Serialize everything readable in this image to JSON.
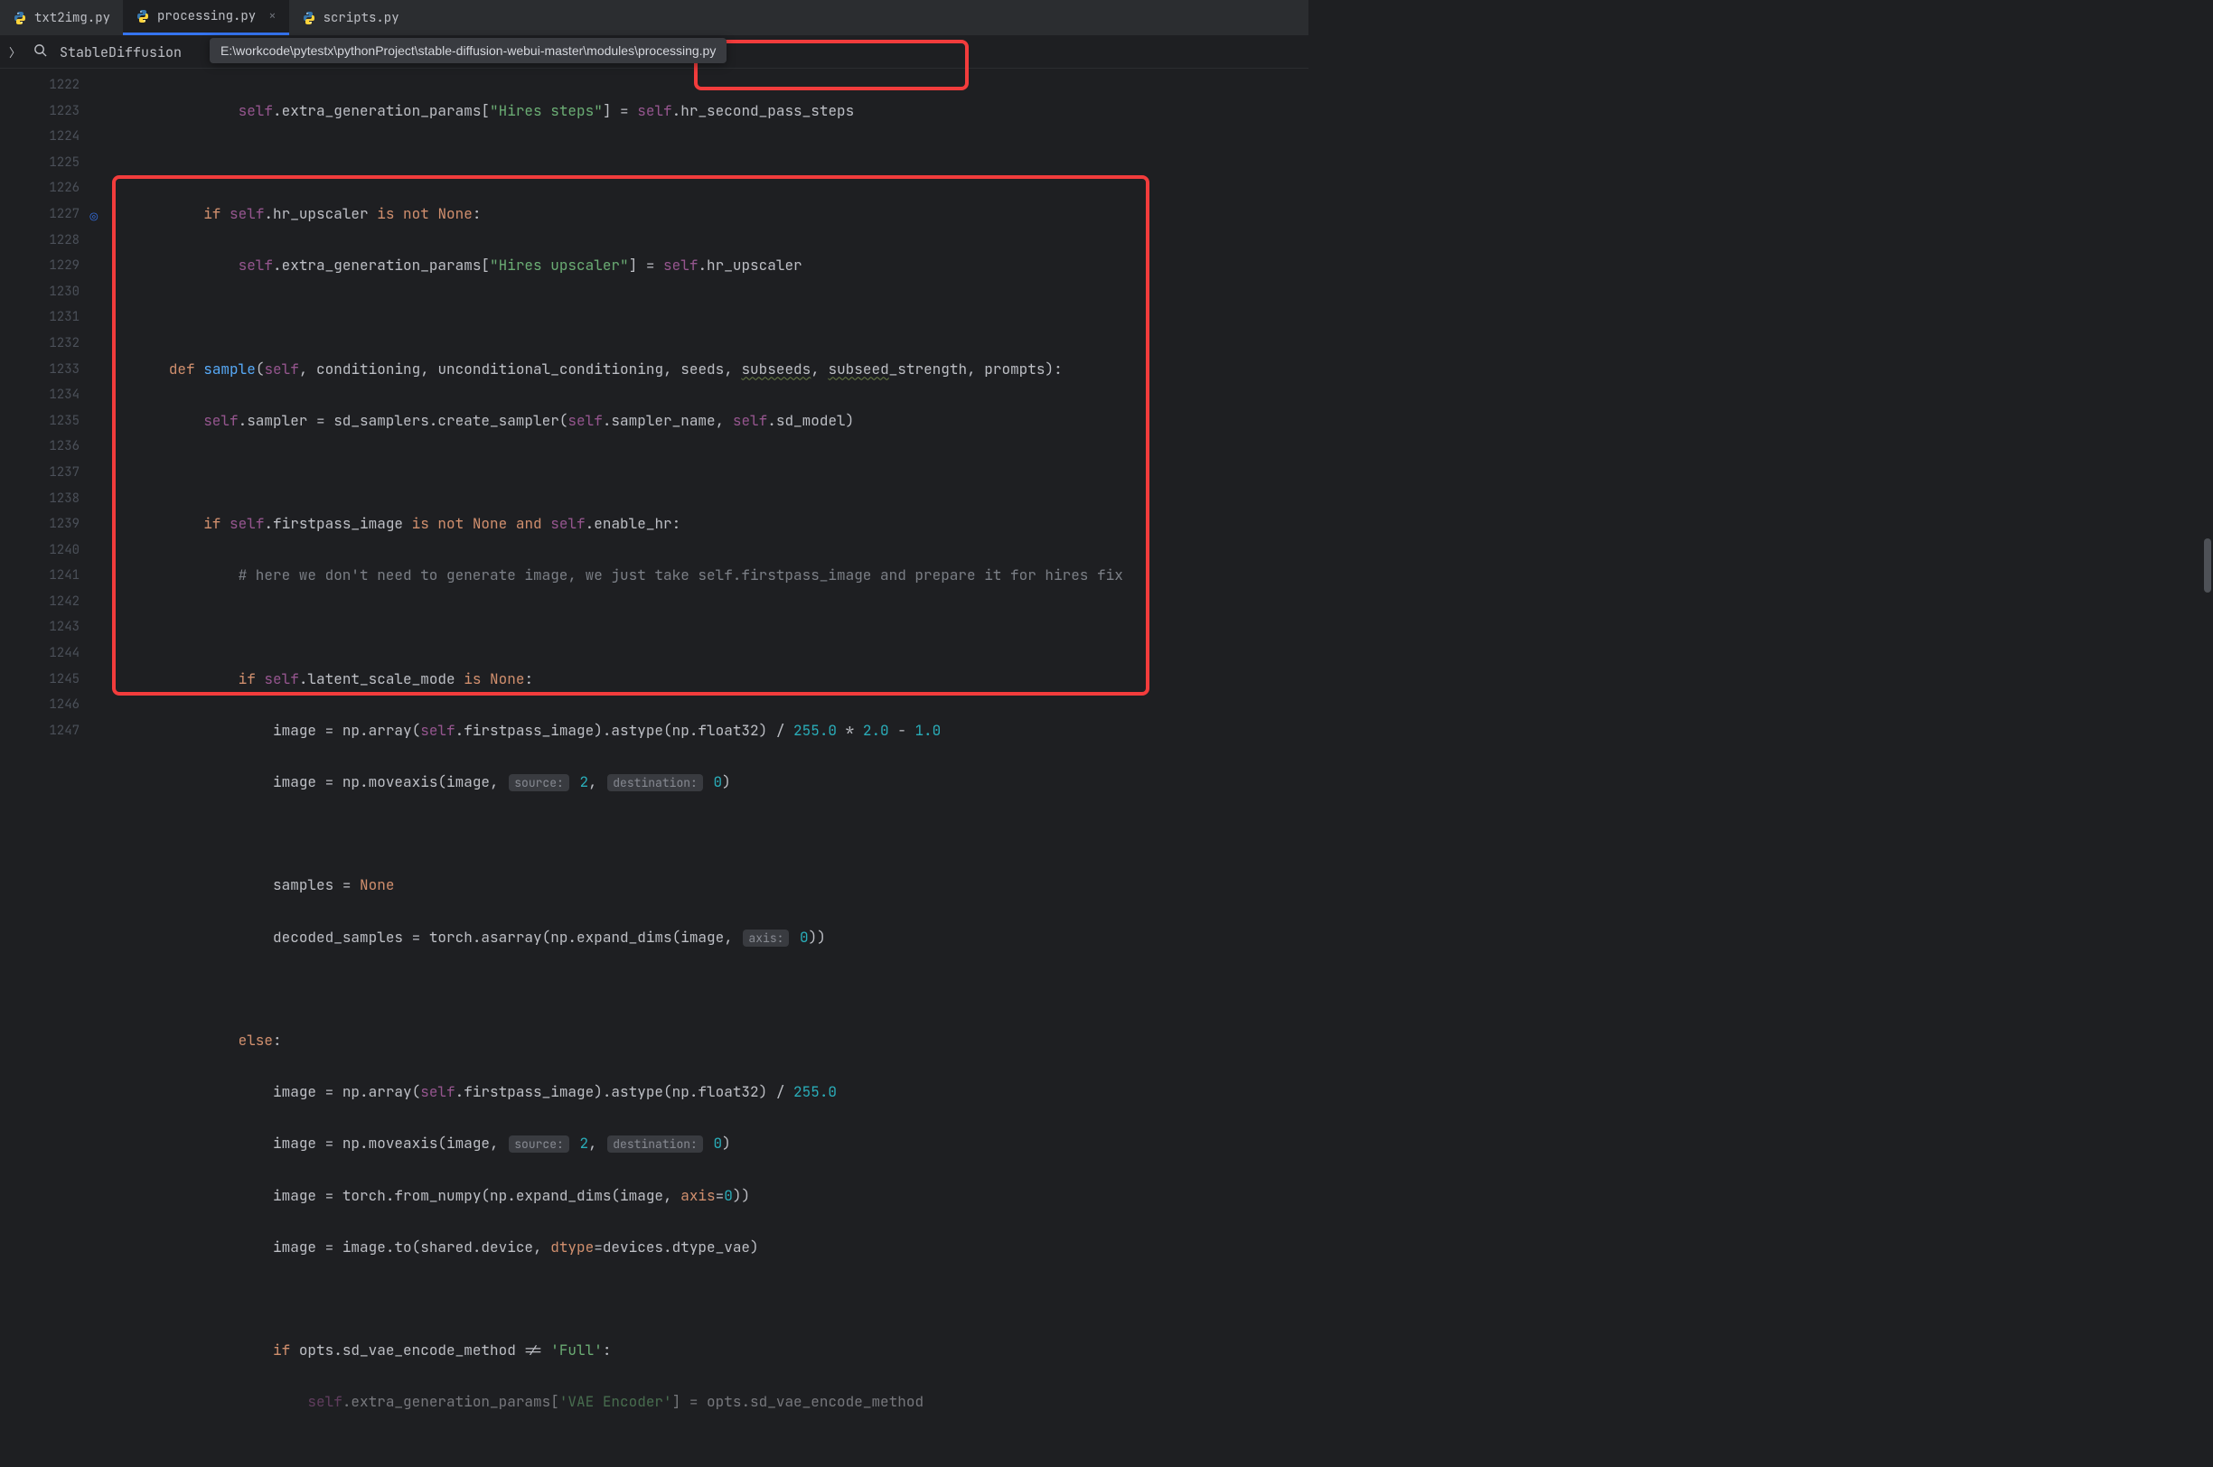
{
  "tabs": [
    {
      "label": "txt2img.py"
    },
    {
      "label": "processing.py"
    },
    {
      "label": "scripts.py"
    }
  ],
  "breadcrumb": "StableDiffusion",
  "tooltip": "E:\\workcode\\pytestx\\pythonProject\\stable-diffusion-webui-master\\modules\\processing.py",
  "line_start": 1222,
  "line_end": 1247,
  "hints": {
    "source": "source:",
    "dest": "destination:",
    "axis": "axis:"
  },
  "code": {
    "c1222_a": "self",
    "c1222_b": ".extra_generation_params[",
    "c1222_c": "\"Hires steps\"",
    "c1222_d": "] = ",
    "c1222_e": "self",
    "c1222_f": ".hr_second_pass_steps",
    "c1224_a": "if ",
    "c1224_b": "self",
    "c1224_c": ".hr_upscaler ",
    "c1224_d": "is not ",
    "c1224_e": "None",
    "c1224_f": ":",
    "c1225_a": "self",
    "c1225_b": ".extra_generation_params[",
    "c1225_c": "\"Hires upscaler\"",
    "c1225_d": "] = ",
    "c1225_e": "self",
    "c1225_f": ".hr_upscaler",
    "c1227_a": "def ",
    "c1227_b": "sample",
    "c1227_c": "(",
    "c1227_d": "self",
    "c1227_e": ", conditioning, unconditional_conditioning, seeds, ",
    "c1227_f": "subseeds",
    "c1227_g": ", ",
    "c1227_h": "subseed",
    "c1227_i": "_strength, prompts):",
    "c1228_a": "self",
    "c1228_b": ".sampler = sd_samplers.create_sampler(",
    "c1228_c": "self",
    "c1228_d": ".sampler_name, ",
    "c1228_e": "self",
    "c1228_f": ".sd_model)",
    "c1230_a": "if ",
    "c1230_b": "self",
    "c1230_c": ".firstpass_image ",
    "c1230_d": "is not ",
    "c1230_e": "None ",
    "c1230_f": "and ",
    "c1230_g": "self",
    "c1230_h": ".enable_hr:",
    "c1231": "# here we don't need to generate image, we just take self.firstpass_image and prepare it for hires fix",
    "c1233_a": "if ",
    "c1233_b": "self",
    "c1233_c": ".latent_scale_mode ",
    "c1233_d": "is ",
    "c1233_e": "None",
    "c1233_f": ":",
    "c1234_a": "image = np.array(",
    "c1234_b": "self",
    "c1234_c": ".firstpass_image).astype(np.float32) / ",
    "c1234_d": "255.0 ",
    "c1234_e": "* ",
    "c1234_f": "2.0 ",
    "c1234_g": "- ",
    "c1234_h": "1.0",
    "c1235_a": "image = np.moveaxis(image, ",
    "c1235_b": "2",
    "c1235_c": ", ",
    "c1235_d": "0",
    "c1235_e": ")",
    "c1237_a": "samples = ",
    "c1237_b": "None",
    "c1238_a": "decoded_samples = torch.asarray(np.expand_dims(image, ",
    "c1238_b": "0",
    "c1238_c": "))",
    "c1240_a": "else",
    "c1240_b": ":",
    "c1241_a": "image = np.array(",
    "c1241_b": "self",
    "c1241_c": ".firstpass_image).astype(np.float32) / ",
    "c1241_d": "255.0",
    "c1242_a": "image = np.moveaxis(image, ",
    "c1242_b": "2",
    "c1242_c": ", ",
    "c1242_d": "0",
    "c1242_e": ")",
    "c1243_a": "image = torch.from_numpy(np.expand_dims(image, ",
    "c1243_b": "axis",
    "c1243_c": "=",
    "c1243_d": "0",
    "c1243_e": "))",
    "c1244_a": "image = image.to(shared.device, ",
    "c1244_b": "dtype",
    "c1244_c": "=devices.dtype_vae)",
    "c1246_a": "if ",
    "c1246_b": "opts.sd_vae_encode_method != ",
    "c1246_c": "'Full'",
    "c1246_d": ":",
    "c1247_a": "self",
    "c1247_b": ".extra_generation_params[",
    "c1247_c": "'VAE Encoder'",
    "c1247_d": "] = opts.sd_vae_encode_method"
  }
}
